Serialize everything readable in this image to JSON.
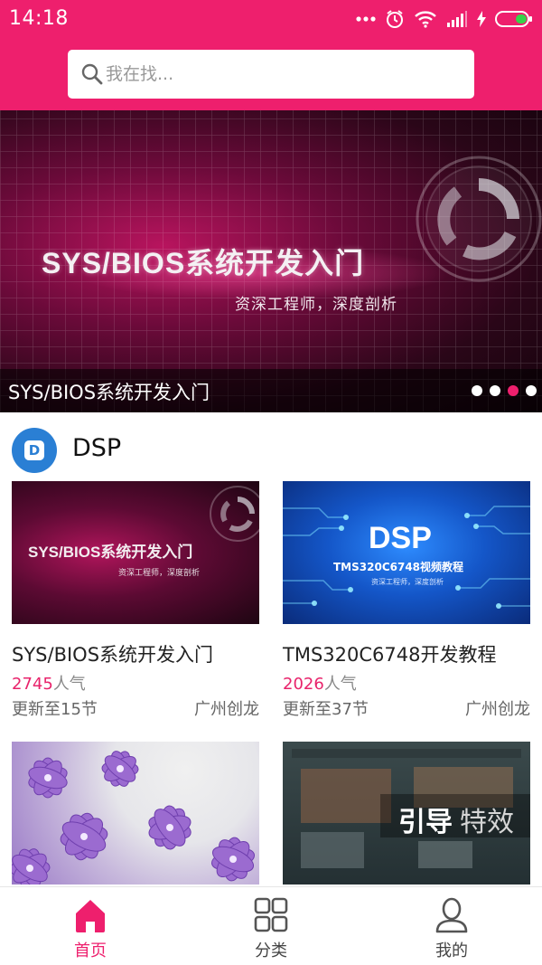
{
  "status_bar": {
    "time": "14:18",
    "icons": [
      "more-dots-icon",
      "alarm-icon",
      "wifi-icon",
      "signal-icon",
      "charging-icon",
      "battery-icon"
    ]
  },
  "search": {
    "placeholder": "我在找..."
  },
  "banner": {
    "image_title": "SYS/BIOS系统开发入门",
    "image_subtitle": "资深工程师，深度剖析",
    "caption": "SYS/BIOS系统开发入门",
    "slide_count": 4,
    "active_index": 2
  },
  "section": {
    "logo_letter": "D",
    "title": "DSP"
  },
  "courses": [
    {
      "title": "SYS/BIOS系统开发入门",
      "popularity": "2745",
      "popularity_suffix": "人气",
      "update": "更新至15节",
      "author": "广州创龙",
      "thumb_title": "SYS/BIOS系统开发入门",
      "thumb_sub": "资深工程师，深度剖析"
    },
    {
      "title": "TMS320C6748开发教程",
      "popularity": "2026",
      "popularity_suffix": "人气",
      "update": "更新至37节",
      "author": "广州创龙",
      "thumb_title": "DSP",
      "thumb_sub": "TMS320C6748视频教程",
      "thumb_sub2": "资深工程师，深度剖析"
    },
    {
      "thumb": "flower-image"
    },
    {
      "thumb_title_bold": "引导",
      "thumb_title_light": "特效"
    }
  ],
  "bottom_nav": [
    {
      "label": "首页",
      "icon": "home-icon",
      "active": true
    },
    {
      "label": "分类",
      "icon": "category-grid-icon",
      "active": false
    },
    {
      "label": "我的",
      "icon": "user-icon",
      "active": false
    }
  ],
  "colors": {
    "brand": "#ee1f6d",
    "popularity_number": "#e8236b",
    "section_logo": "#2a7fd4"
  }
}
